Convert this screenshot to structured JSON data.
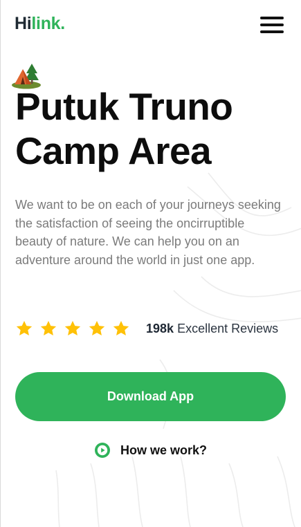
{
  "brand": {
    "logo_part1": "Hi",
    "logo_part2": "link."
  },
  "nav": {
    "menu_icon": "hamburger-menu-icon"
  },
  "hero": {
    "emoji_icon": "camping-tent-icon",
    "title_line1": "Putuk Truno",
    "title_line2": "Camp Area",
    "description": "We want to be on each of your journeys seeking the satisfaction of seeing the oncirruptible beauty of nature. We can help you on an adventure around the world in just one app."
  },
  "rating": {
    "stars": 5,
    "star_color": "#FFC107",
    "count": "198k",
    "label": "Excellent Reviews"
  },
  "cta": {
    "download_label": "Download App",
    "how_label": "How we work?",
    "accent_color": "#2FB35A"
  }
}
